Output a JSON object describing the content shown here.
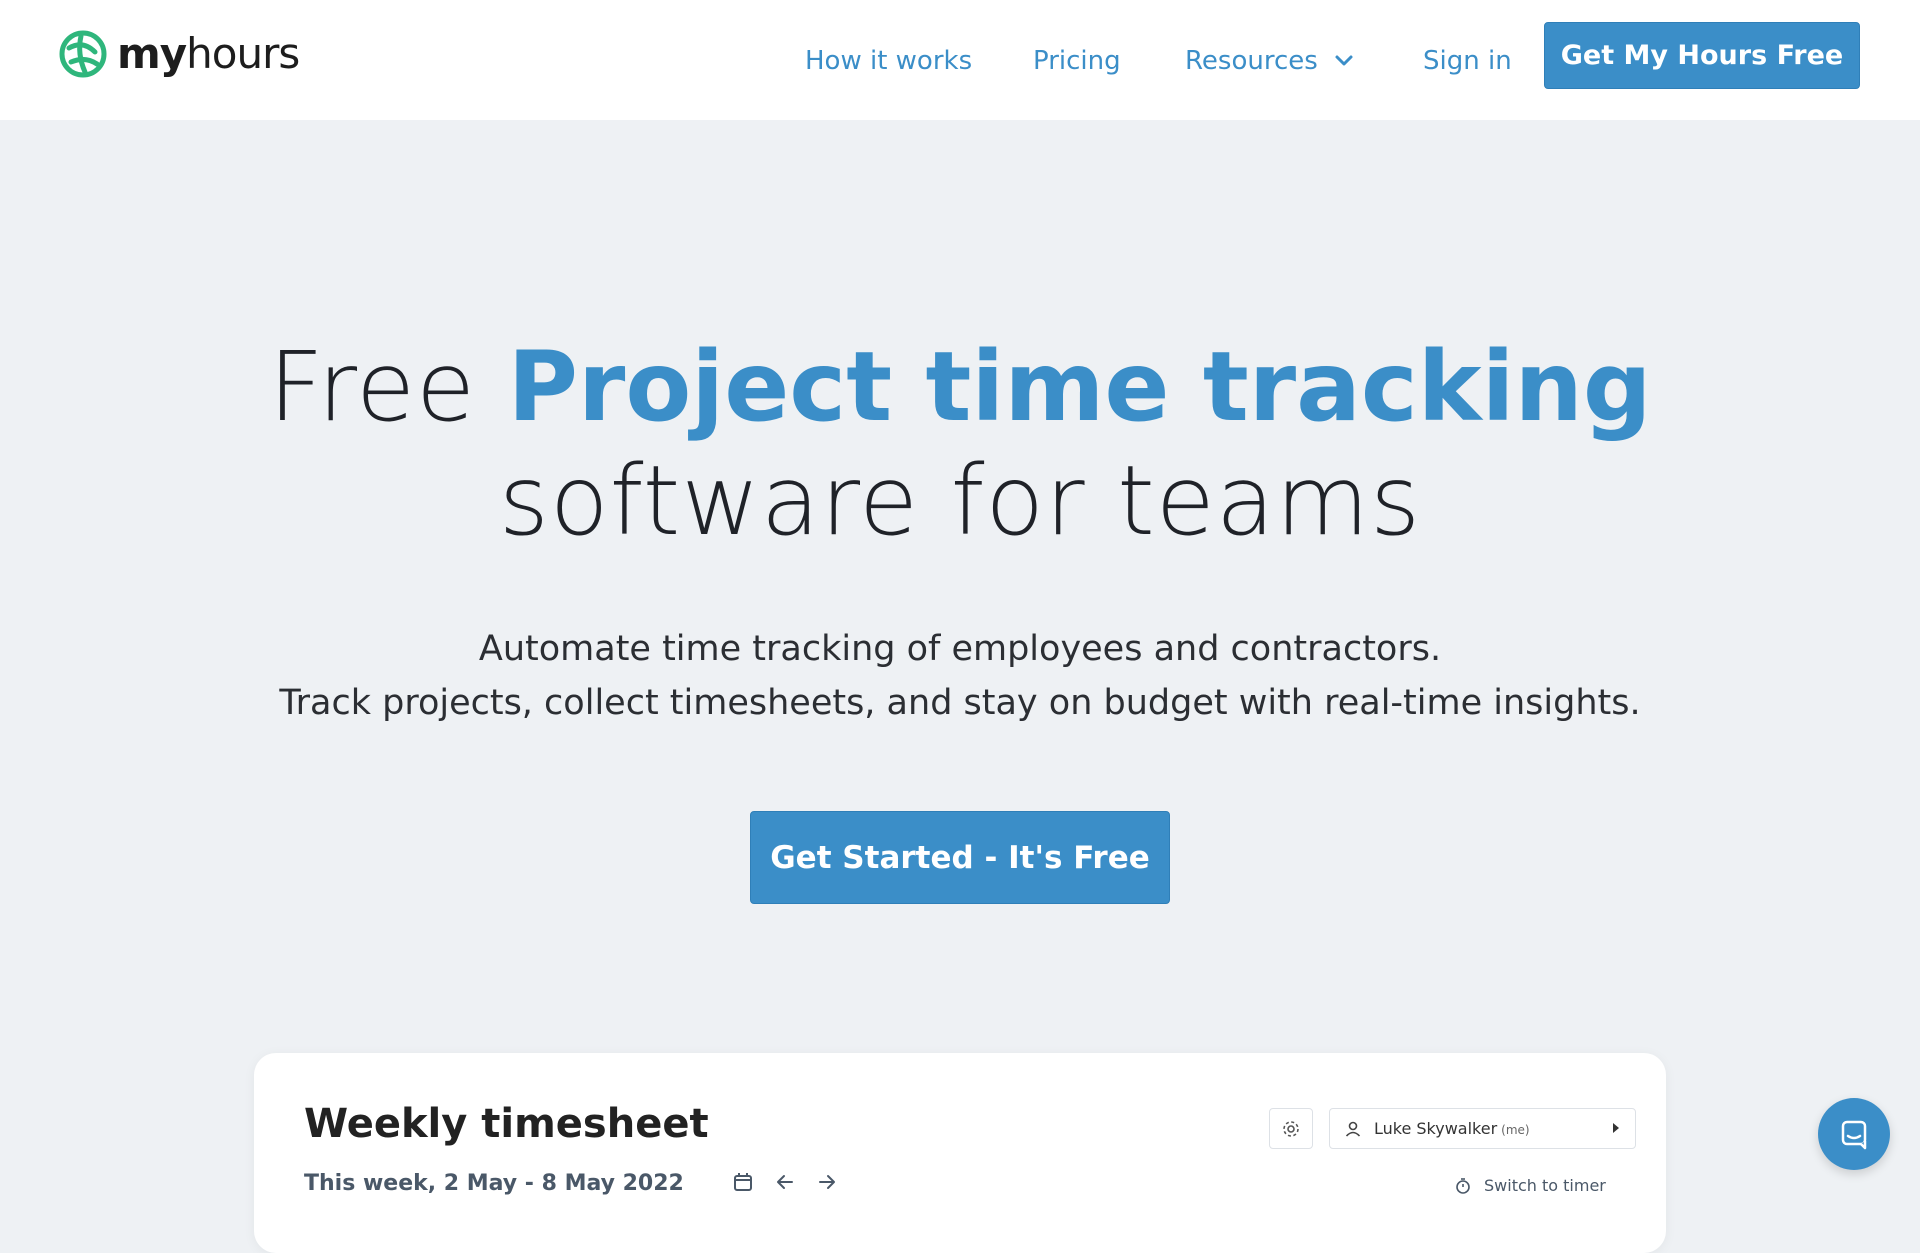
{
  "header": {
    "logo_bold": "my",
    "logo_light": "hours",
    "nav": {
      "how_it_works": "How it works",
      "pricing": "Pricing",
      "resources": "Resources",
      "sign_in": "Sign in"
    },
    "cta_label": "Get My Hours Free"
  },
  "hero": {
    "title_plain": "Free",
    "title_accent": "Project time tracking",
    "title_line2": "software for teams",
    "subtitle_line1": "Automate time tracking of employees and contractors.",
    "subtitle_line2": "Track projects, collect timesheets, and stay on budget with real-time insights.",
    "cta_label": "Get Started - It's Free"
  },
  "preview": {
    "title": "Weekly timesheet",
    "week_label": "This week, 2 May - 8 May 2022",
    "user_name": "Luke Skywalker",
    "user_suffix": "(me)",
    "switch_label": "Switch to timer"
  },
  "icons": {
    "logo": "myhours-logo-icon",
    "resources_dropdown": "chevron-down-icon",
    "calendar": "calendar-icon",
    "prev": "arrow-left-icon",
    "next": "arrow-right-icon",
    "settings": "gear-icon",
    "user": "user-icon",
    "timer": "stopwatch-icon",
    "chat": "chat-icon"
  },
  "colors": {
    "brand_blue": "#3b8ec8",
    "brand_green": "#2fb67c",
    "page_bg": "#eef1f4",
    "text_dark": "#1f2228"
  }
}
